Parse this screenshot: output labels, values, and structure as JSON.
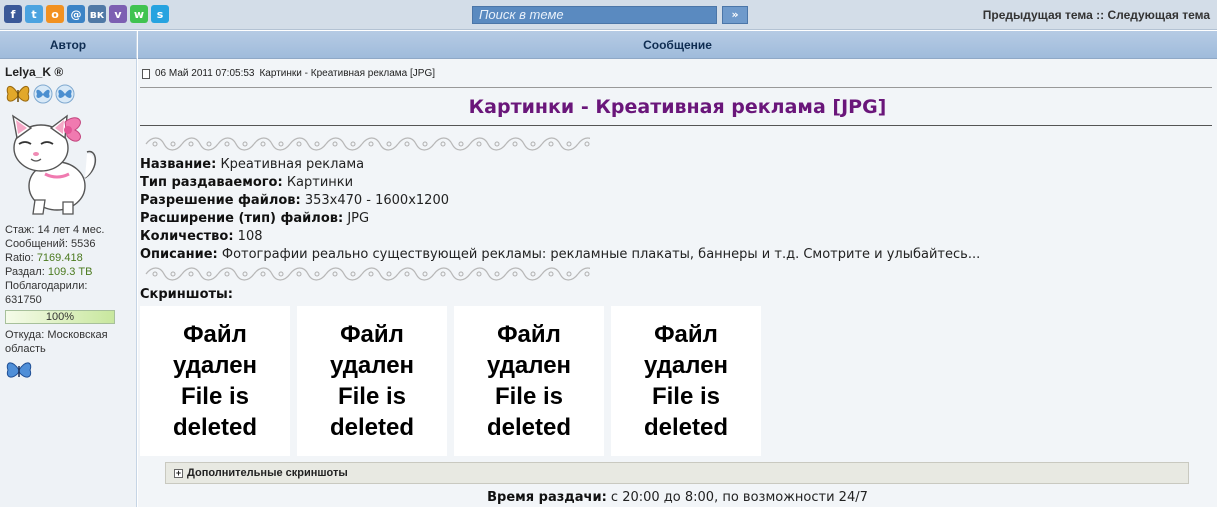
{
  "topbar": {
    "social": [
      {
        "name": "facebook-icon",
        "glyph": "f",
        "color": "#3b5998"
      },
      {
        "name": "twitter-icon",
        "glyph": "t",
        "color": "#4ba3e0"
      },
      {
        "name": "odnoklassniki-icon",
        "glyph": "о",
        "color": "#f29120"
      },
      {
        "name": "moimir-icon",
        "glyph": "@",
        "color": "#3b83c6"
      },
      {
        "name": "vk-icon",
        "glyph": "вк",
        "color": "#5079a6"
      },
      {
        "name": "viber-icon",
        "glyph": "v",
        "color": "#7d5fb2"
      },
      {
        "name": "whatsapp-icon",
        "glyph": "w",
        "color": "#40c351"
      },
      {
        "name": "skype-icon",
        "glyph": "s",
        "color": "#26a3e0"
      }
    ],
    "search_placeholder": "Поиск в теме",
    "search_button": "»",
    "prev_topic": "Предыдущая тема",
    "nav_sep": "::",
    "next_topic": "Следующая тема"
  },
  "header": {
    "author": "Автор",
    "message": "Сообщение"
  },
  "author": {
    "username": "Lelya_K",
    "reg_mark": "®",
    "stats": {
      "experience": "Стаж: 14 лет 4 мес.",
      "posts": "Сообщений: 5536",
      "ratio_label": "Ratio:",
      "ratio_value": "7169.418",
      "upload_label": "Раздал:",
      "upload_value": "109.3 TB",
      "thanks_label": "Поблагодарили:",
      "thanks_value": "631750"
    },
    "progress_percent": 100,
    "progress_label": "100%",
    "location_label": "Откуда:",
    "location_value": "Московская область"
  },
  "post": {
    "date": "06 Май 2011 07:05:53",
    "meta_title": "Картинки - Креативная реклама [JPG]",
    "title": "Картинки - Креативная реклама [JPG]",
    "fields": [
      {
        "label": "Название:",
        "value": "Креативная реклама"
      },
      {
        "label": "Тип раздаваемого:",
        "value": "Картинки"
      },
      {
        "label": "Разрешение файлов:",
        "value": "353x470 - 1600x1200"
      },
      {
        "label": "Расширение (тип) файлов:",
        "value": "JPG"
      },
      {
        "label": "Количество:",
        "value": "108"
      },
      {
        "label": "Описание:",
        "value": "Фотографии реально существующей рекламы: рекламные плакаты, баннеры и т.д. Смотрите и улыбайтесь..."
      }
    ],
    "screenshots_label": "Скриншоты:",
    "deleted_lines": [
      "Файл",
      "удален",
      "File is",
      "deleted"
    ],
    "thumb_count": 4,
    "spoiler_label": "Дополнительные скриншоты",
    "seed_label": "Время раздачи:",
    "seed_value": "с 20:00 до 8:00, по возможности 24/7"
  },
  "colors": {
    "title": "#6a167a",
    "ratio": "#4b7a1f"
  }
}
